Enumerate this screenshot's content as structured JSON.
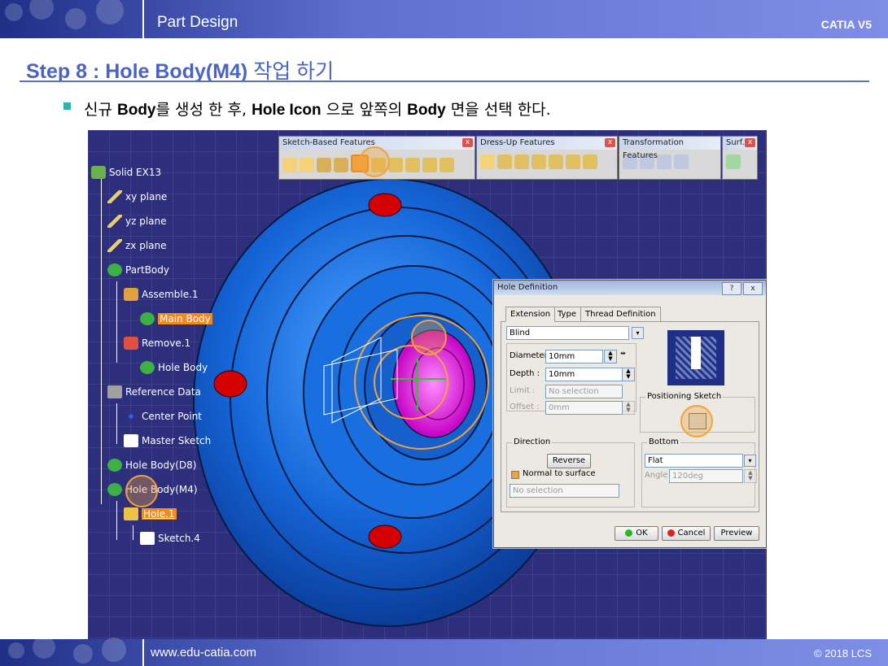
{
  "header": {
    "section": "Part Design",
    "product": "CATIA V5"
  },
  "footer": {
    "url": "www.edu-catia.com",
    "copyright": "© 2018 LCS"
  },
  "step": {
    "prefix": "Step 8 : ",
    "title_bold": "Hole Body(M4)",
    "title_rest": " 작업 하기"
  },
  "bullet": {
    "p1": "신규 ",
    "b1": "Body",
    "p2": "를 생성 한 후, ",
    "b2": "Hole Icon",
    "p3": " 으로 앞쪽의 ",
    "b3": "Body",
    "p4": " 면을 선택 한다."
  },
  "tree": {
    "root": "Solid EX13",
    "xy": "xy plane",
    "yz": "yz plane",
    "zx": "zx plane",
    "partbody": "PartBody",
    "assemble": "Assemble.1",
    "mainbody": "Main Body",
    "remove": "Remove.1",
    "holebody": "Hole Body",
    "refdata": "Reference Data",
    "center": "Center Point",
    "master": "Master Sketch",
    "holed8": "Hole Body(D8)",
    "holem4": "Hole Body(M4)",
    "hole1": "Hole.1",
    "sketch4": "Sketch.4"
  },
  "toolbars": {
    "sketch": "Sketch-Based Features",
    "dressup": "Dress-Up Features",
    "transform": "Transformation Features",
    "surf": "Surf..."
  },
  "dialog": {
    "title": "Hole Definition",
    "help": "?",
    "close": "x",
    "tabs": [
      "Extension",
      "Type",
      "Thread Definition"
    ],
    "extension_type": "Blind",
    "diameter_label": "Diameter :",
    "diameter": "10mm",
    "depth_label": "Depth :",
    "depth": "10mm",
    "limit_label": "Limit :",
    "limit": "No selection",
    "offset_label": "Offset :",
    "offset": "0mm",
    "positioning": "Positioning Sketch",
    "direction": "Direction",
    "reverse": "Reverse",
    "normal": "Normal to surface",
    "dir_sel": "No selection",
    "bottom": "Bottom",
    "bottom_type": "Flat",
    "angle_label": "Angle :",
    "angle": "120deg",
    "ok": "OK",
    "cancel": "Cancel",
    "preview": "Preview"
  },
  "colors": {
    "accent": "#4a63c6",
    "viewport": "#2e2f7c",
    "highlight": "#f28a1e",
    "part": "#1565d8"
  }
}
